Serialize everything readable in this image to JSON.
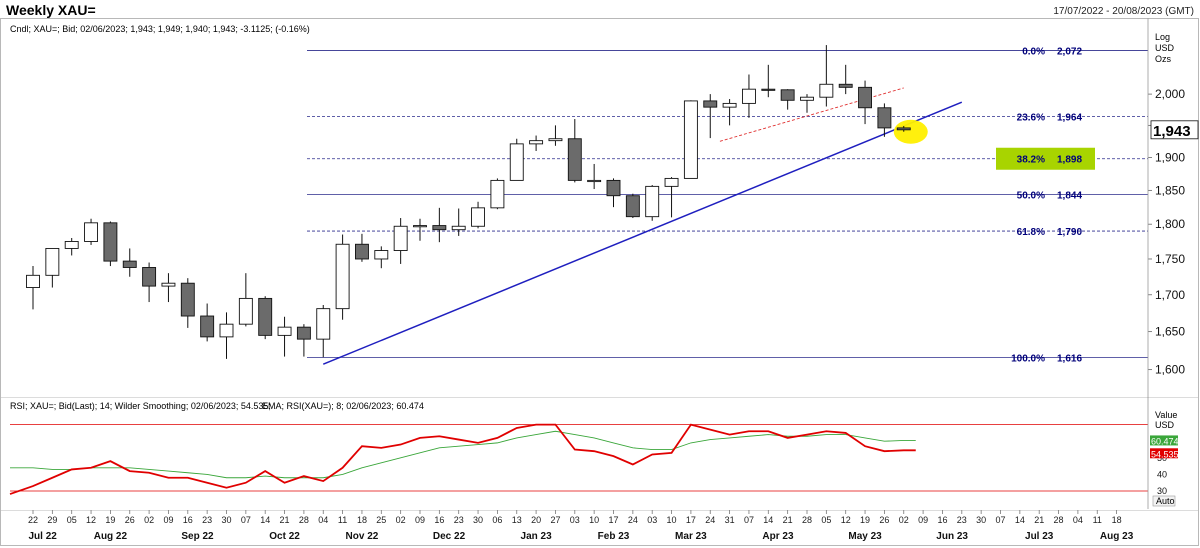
{
  "header": {
    "title": "Weekly XAU=",
    "date_range": "17/07/2022 - 20/08/2023 (GMT)"
  },
  "main_panel": {
    "info_line": "Cndl; XAU=; Bid; 02/06/2023; 1,943; 1,949; 1,940; 1,943; -3.1125; (-0.16%)",
    "axis_header": [
      "Log",
      "USD",
      "Ozs"
    ],
    "last_price_label": "1,943"
  },
  "rsi_panel": {
    "info_line_rsi": "RSI; XAU=; Bid(Last); 14; Wilder Smoothing; 02/06/2023; 54.535;",
    "info_line_ema": "EMA; RSI(XAU=); 8; 02/06/2023; 60.474",
    "axis_header": [
      "Value",
      "USD"
    ],
    "rsi_value_label": "54.535",
    "ema_value_label": "60.474",
    "auto_label": "Auto"
  },
  "colors": {
    "bull_fill": "#ffffff",
    "bear_fill": "#6b6b6b",
    "fib_line": "#2b2b8c",
    "trendline": "#1f1fbf",
    "red_trendline": "#e03030",
    "rsi_line": "#e00000",
    "ema_line": "#3aa63a",
    "highlight_yellow": "#ffef00",
    "highlight_green": "#a8d400",
    "label_blue": "#00007a"
  },
  "chart_data": [
    {
      "type": "candlestick",
      "title": "Weekly XAU=",
      "y_scale": "log",
      "ylim": [
        1570,
        2110
      ],
      "yticks": [
        1600,
        1650,
        1700,
        1750,
        1800,
        1850,
        1900,
        1950,
        2000
      ],
      "ytick_labels": [
        "1,600",
        "1,650",
        "1,700",
        "1,750",
        "1,800",
        "1,850",
        "1,900",
        "1,950",
        "2,000"
      ],
      "x_ticks": [
        "22",
        "29",
        "05",
        "12",
        "19",
        "26",
        "02",
        "09",
        "16",
        "23",
        "30",
        "07",
        "14",
        "21",
        "28",
        "04",
        "11",
        "18",
        "25",
        "02",
        "09",
        "16",
        "23",
        "30",
        "06",
        "13",
        "20",
        "27",
        "03",
        "10",
        "17",
        "24",
        "03",
        "10",
        "17",
        "24",
        "31",
        "07",
        "14",
        "21",
        "28",
        "05",
        "12",
        "19",
        "26",
        "02",
        "09",
        "16",
        "23",
        "30",
        "07",
        "14",
        "21",
        "28",
        "04",
        "11",
        "18"
      ],
      "x_month_labels": [
        {
          "label": "Jul 22",
          "tick_index": 0.5
        },
        {
          "label": "Aug 22",
          "tick_index": 4
        },
        {
          "label": "Sep 22",
          "tick_index": 8.5
        },
        {
          "label": "Oct 22",
          "tick_index": 13
        },
        {
          "label": "Nov 22",
          "tick_index": 17
        },
        {
          "label": "Dec 22",
          "tick_index": 21.5
        },
        {
          "label": "Jan 23",
          "tick_index": 26
        },
        {
          "label": "Feb 23",
          "tick_index": 30
        },
        {
          "label": "Mar 23",
          "tick_index": 34
        },
        {
          "label": "Apr 23",
          "tick_index": 38.5
        },
        {
          "label": "May 23",
          "tick_index": 43
        },
        {
          "label": "Jun 23",
          "tick_index": 47.5
        },
        {
          "label": "Jul 23",
          "tick_index": 52
        },
        {
          "label": "Aug 23",
          "tick_index": 56
        }
      ],
      "candles": [
        {
          "o": 1710,
          "h": 1740,
          "l": 1680,
          "c": 1727
        },
        {
          "o": 1727,
          "h": 1765,
          "l": 1710,
          "c": 1765
        },
        {
          "o": 1765,
          "h": 1780,
          "l": 1755,
          "c": 1775
        },
        {
          "o": 1775,
          "h": 1808,
          "l": 1770,
          "c": 1802
        },
        {
          "o": 1802,
          "h": 1804,
          "l": 1740,
          "c": 1747
        },
        {
          "o": 1747,
          "h": 1765,
          "l": 1725,
          "c": 1738
        },
        {
          "o": 1738,
          "h": 1745,
          "l": 1690,
          "c": 1712
        },
        {
          "o": 1712,
          "h": 1730,
          "l": 1690,
          "c": 1716
        },
        {
          "o": 1716,
          "h": 1723,
          "l": 1655,
          "c": 1671
        },
        {
          "o": 1671,
          "h": 1688,
          "l": 1637,
          "c": 1643
        },
        {
          "o": 1643,
          "h": 1676,
          "l": 1614,
          "c": 1660
        },
        {
          "o": 1660,
          "h": 1730,
          "l": 1657,
          "c": 1695
        },
        {
          "o": 1695,
          "h": 1698,
          "l": 1640,
          "c": 1645
        },
        {
          "o": 1645,
          "h": 1670,
          "l": 1617,
          "c": 1656
        },
        {
          "o": 1656,
          "h": 1660,
          "l": 1617,
          "c": 1640
        },
        {
          "o": 1640,
          "h": 1686,
          "l": 1616,
          "c": 1681
        },
        {
          "o": 1681,
          "h": 1785,
          "l": 1666,
          "c": 1771
        },
        {
          "o": 1771,
          "h": 1786,
          "l": 1746,
          "c": 1750
        },
        {
          "o": 1750,
          "h": 1768,
          "l": 1737,
          "c": 1762
        },
        {
          "o": 1762,
          "h": 1809,
          "l": 1743,
          "c": 1797
        },
        {
          "o": 1797,
          "h": 1808,
          "l": 1776,
          "c": 1798
        },
        {
          "o": 1798,
          "h": 1824,
          "l": 1774,
          "c": 1792
        },
        {
          "o": 1792,
          "h": 1823,
          "l": 1783,
          "c": 1797
        },
        {
          "o": 1797,
          "h": 1833,
          "l": 1794,
          "c": 1824
        },
        {
          "o": 1824,
          "h": 1868,
          "l": 1822,
          "c": 1865
        },
        {
          "o": 1865,
          "h": 1929,
          "l": 1865,
          "c": 1921
        },
        {
          "o": 1921,
          "h": 1934,
          "l": 1910,
          "c": 1926
        },
        {
          "o": 1926,
          "h": 1950,
          "l": 1918,
          "c": 1929
        },
        {
          "o": 1929,
          "h": 1960,
          "l": 1862,
          "c": 1865
        },
        {
          "o": 1865,
          "h": 1890,
          "l": 1852,
          "c": 1865
        },
        {
          "o": 1865,
          "h": 1868,
          "l": 1825,
          "c": 1842
        },
        {
          "o": 1842,
          "h": 1845,
          "l": 1809,
          "c": 1811
        },
        {
          "o": 1811,
          "h": 1858,
          "l": 1805,
          "c": 1856
        },
        {
          "o": 1856,
          "h": 1870,
          "l": 1810,
          "c": 1868
        },
        {
          "o": 1868,
          "h": 1990,
          "l": 1868,
          "c": 1989
        },
        {
          "o": 1989,
          "h": 2000,
          "l": 1930,
          "c": 1979
        },
        {
          "o": 1979,
          "h": 1992,
          "l": 1950,
          "c": 1985
        },
        {
          "o": 1985,
          "h": 2032,
          "l": 1962,
          "c": 2008
        },
        {
          "o": 2008,
          "h": 2048,
          "l": 1995,
          "c": 2007
        },
        {
          "o": 2007,
          "h": 2008,
          "l": 1975,
          "c": 1990
        },
        {
          "o": 1990,
          "h": 2000,
          "l": 1970,
          "c": 1995
        },
        {
          "o": 1995,
          "h": 2081,
          "l": 1980,
          "c": 2016
        },
        {
          "o": 2016,
          "h": 2048,
          "l": 2000,
          "c": 2011
        },
        {
          "o": 2011,
          "h": 2022,
          "l": 1952,
          "c": 1978
        },
        {
          "o": 1978,
          "h": 1985,
          "l": 1932,
          "c": 1946
        },
        {
          "o": 1946,
          "h": 1949,
          "l": 1940,
          "c": 1943
        }
      ],
      "fibonacci_levels": [
        {
          "pct": "0.0%",
          "value": 2072,
          "label": "2,072",
          "style": "solid"
        },
        {
          "pct": "23.6%",
          "value": 1964,
          "label": "1,964",
          "style": "dashed"
        },
        {
          "pct": "38.2%",
          "value": 1898,
          "label": "1,898",
          "style": "dashed",
          "highlight": true
        },
        {
          "pct": "50.0%",
          "value": 1844,
          "label": "1,844",
          "style": "solid"
        },
        {
          "pct": "61.8%",
          "value": 1790,
          "label": "1,790",
          "style": "dashed"
        },
        {
          "pct": "100.0%",
          "value": 1616,
          "label": "1,616",
          "style": "solid"
        }
      ],
      "trendline_support": {
        "from": {
          "index": 15,
          "value": 1607
        },
        "to": {
          "index": 48,
          "value": 1987
        }
      },
      "trendline_resistance": {
        "from": {
          "index": 35.5,
          "value": 1925
        },
        "to": {
          "index": 45,
          "value": 2010
        }
      },
      "highlight_circle": {
        "index": 45,
        "value": 1943
      }
    },
    {
      "type": "line",
      "title": "RSI",
      "ylim": [
        27,
        77
      ],
      "yticks": [
        30,
        40,
        50
      ],
      "ytick_labels": [
        "30",
        "40",
        "50"
      ],
      "upper_band": 70,
      "lower_band": 30,
      "series": [
        {
          "name": "RSI",
          "values": [
            33,
            38,
            43,
            44,
            48,
            42,
            41,
            38,
            38,
            35,
            32,
            35,
            42,
            35,
            39,
            36,
            44,
            57,
            56,
            58,
            62,
            63,
            61,
            59,
            62,
            68,
            70,
            70,
            55,
            54,
            51,
            46,
            52,
            53,
            70,
            67,
            64,
            66,
            66,
            62,
            64,
            66,
            65,
            57,
            54,
            54.535
          ]
        },
        {
          "name": "EMA",
          "values": [
            44,
            43,
            43,
            44,
            44,
            44,
            43,
            42,
            41,
            40,
            38,
            38,
            39,
            38,
            38,
            38,
            40,
            44,
            47,
            50,
            53,
            56,
            57,
            58,
            59,
            62,
            64,
            66,
            64,
            62,
            59,
            56,
            55,
            55,
            59,
            61,
            62,
            63,
            64,
            63,
            63,
            64,
            64,
            62,
            60,
            60.474
          ]
        }
      ]
    }
  ]
}
